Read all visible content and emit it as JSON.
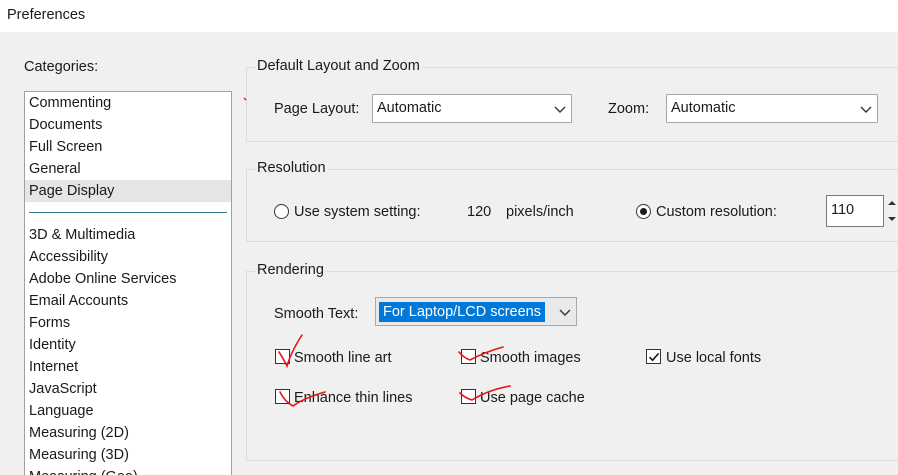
{
  "window": {
    "title": "Preferences"
  },
  "categories": {
    "label": "Categories:",
    "group1": [
      "Commenting",
      "Documents",
      "Full Screen",
      "General",
      "Page Display"
    ],
    "selected": "Page Display",
    "group2": [
      "3D & Multimedia",
      "Accessibility",
      "Adobe Online Services",
      "Email Accounts",
      "Forms",
      "Identity",
      "Internet",
      "JavaScript",
      "Language",
      "Measuring (2D)",
      "Measuring (3D)",
      "Measuring (Geo)"
    ]
  },
  "layout_zoom": {
    "title": "Default Layout and Zoom",
    "page_layout_label": "Page Layout:",
    "page_layout_value": "Automatic",
    "zoom_label": "Zoom:",
    "zoom_value": "Automatic"
  },
  "resolution": {
    "title": "Resolution",
    "system_label": "Use system setting:",
    "system_value": "120",
    "system_unit": "pixels/inch",
    "custom_label": "Custom resolution:",
    "custom_value": "110",
    "selected": "custom"
  },
  "rendering": {
    "title": "Rendering",
    "smooth_text_label": "Smooth Text:",
    "smooth_text_value": "For Laptop/LCD screens",
    "smooth_line_art": {
      "label": "Smooth line art",
      "checked": false
    },
    "smooth_images": {
      "label": "Smooth images",
      "checked": false
    },
    "use_local_fonts": {
      "label": "Use local fonts",
      "checked": true
    },
    "enhance_thin_lines": {
      "label": "Enhance thin lines",
      "checked": false
    },
    "use_page_cache": {
      "label": "Use page cache",
      "checked": false
    }
  },
  "colors": {
    "selection": "#0078d7",
    "annotation": "#e8141c",
    "separator": "#2f7a8a"
  }
}
